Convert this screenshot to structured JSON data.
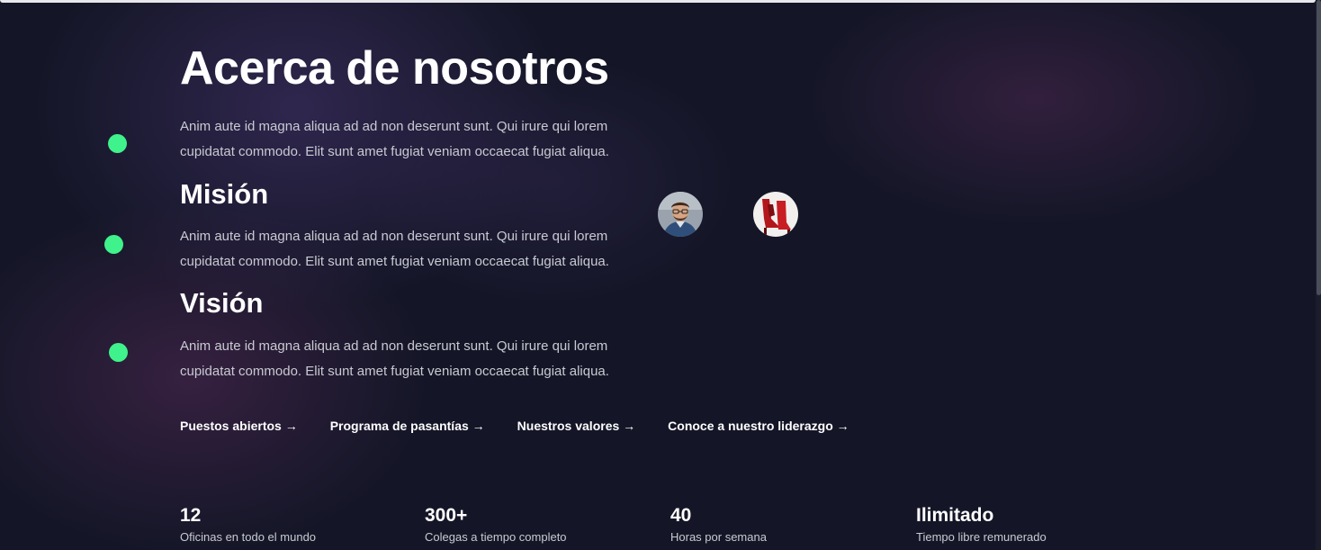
{
  "about": {
    "title": "Acerca de nosotros",
    "text": "Anim aute id magna aliqua ad ad non deserunt sunt. Qui irure qui lorem cupidatat commodo. Elit sunt amet fugiat veniam occaecat fugiat aliqua."
  },
  "mission": {
    "heading": "Misión",
    "text": "Anim aute id magna aliqua ad ad non deserunt sunt. Qui irure qui lorem cupidatat commodo. Elit sunt amet fugiat veniam occaecat fugiat aliqua."
  },
  "vision": {
    "heading": "Visión",
    "text": "Anim aute id magna aliqua ad ad non deserunt sunt. Qui irure qui lorem cupidatat commodo. Elit sunt amet fugiat veniam occaecat fugiat aliqua."
  },
  "links": [
    {
      "label": "Puestos abiertos →"
    },
    {
      "label": "Programa de pasantías →"
    },
    {
      "label": "Nuestros valores →"
    },
    {
      "label": "Conoce a nuestro liderazgo →"
    }
  ],
  "stats": [
    {
      "value": "12",
      "label": "Oficinas en todo el mundo"
    },
    {
      "value": "300+",
      "label": "Colegas a tiempo completo"
    },
    {
      "value": "40",
      "label": "Horas por semana"
    },
    {
      "value": "Ilimitado",
      "label": "Tiempo libre remunerado"
    }
  ],
  "colors": {
    "accent_dot": "#3ff28b",
    "background": "#141627"
  },
  "icons": {
    "avatar_1": "man-portrait-avatar",
    "avatar_2": "red-shoes-avatar"
  }
}
